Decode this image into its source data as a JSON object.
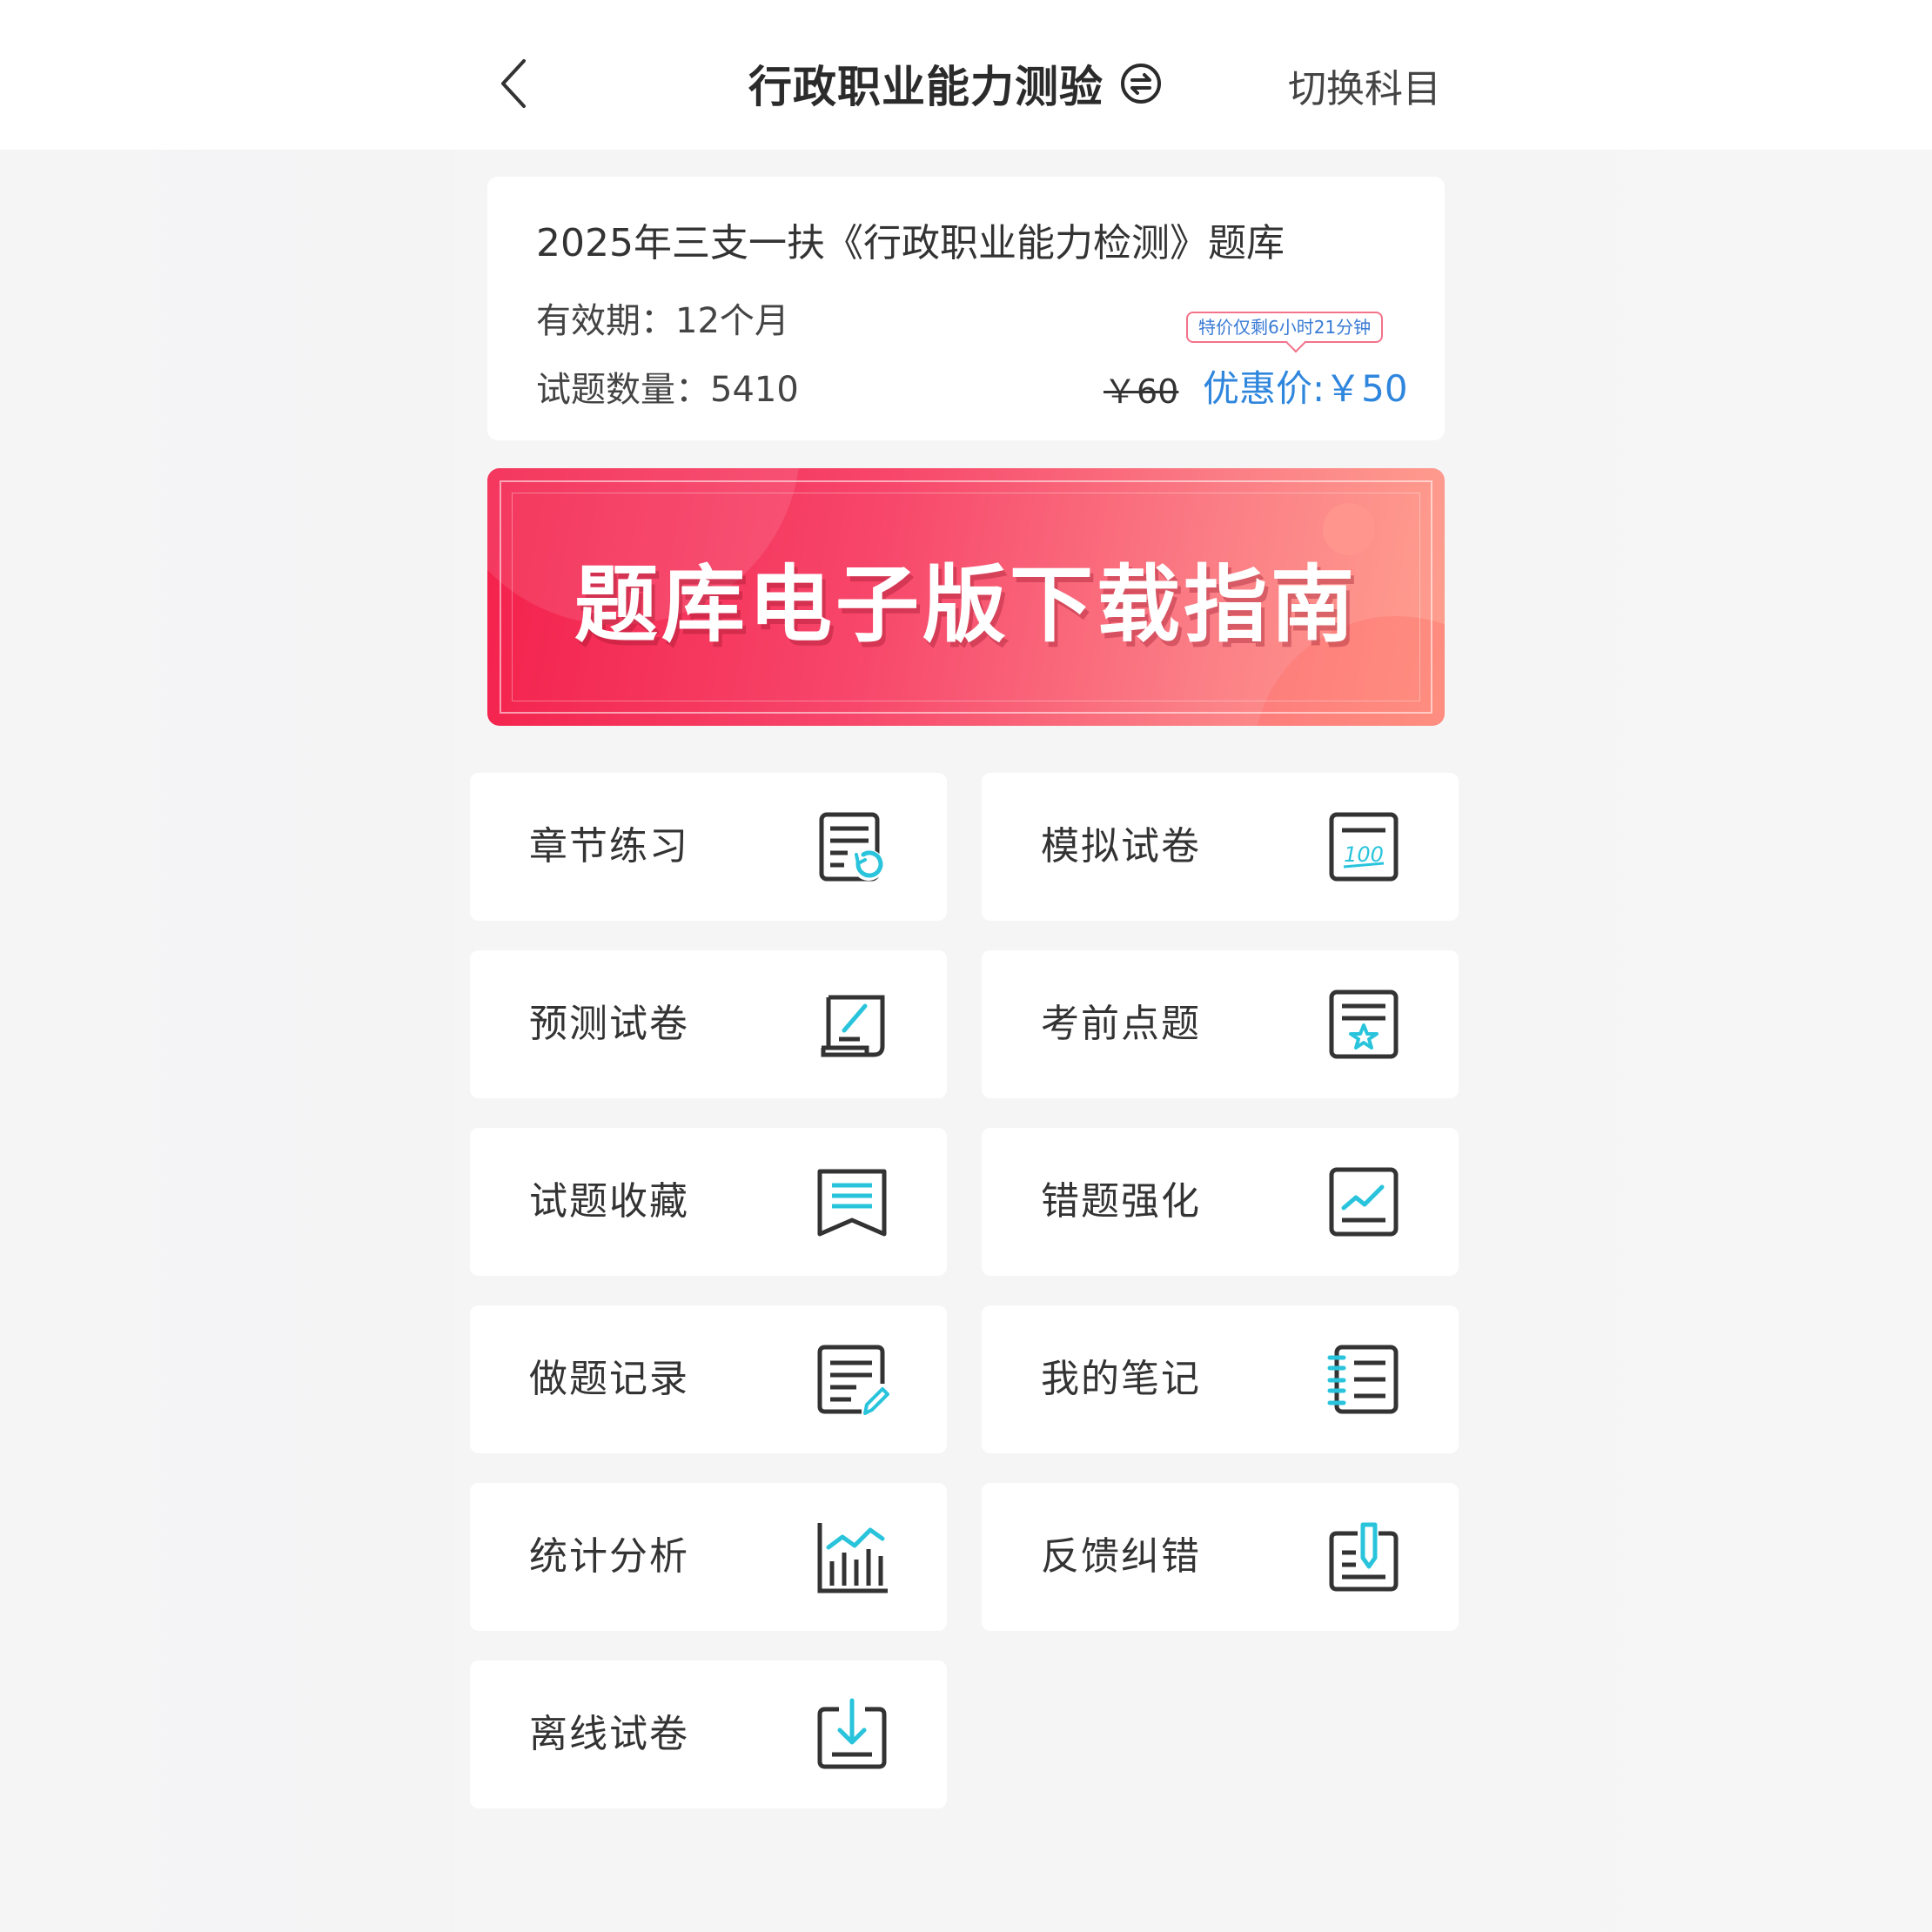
{
  "header": {
    "title": "行政职业能力测验",
    "switch_label": "切换科目"
  },
  "info": {
    "bank_title": "2025年三支一扶《行政职业能力检测》题库",
    "validity": "有效期：12个月",
    "question_count": "试题数量：5410",
    "countdown": "特价仅剩6小时21分钟",
    "old_price": "￥60",
    "sale_price": "优惠价:￥50"
  },
  "banner": {
    "text": "题库电子版下载指南"
  },
  "menu": {
    "items": [
      {
        "label": "章节练习",
        "icon": "chapter-practice-icon"
      },
      {
        "label": "模拟试卷",
        "icon": "mock-exam-icon"
      },
      {
        "label": "预测试卷",
        "icon": "forecast-exam-icon"
      },
      {
        "label": "考前点题",
        "icon": "key-points-icon"
      },
      {
        "label": "试题收藏",
        "icon": "favorites-icon"
      },
      {
        "label": "错题强化",
        "icon": "mistakes-icon"
      },
      {
        "label": "做题记录",
        "icon": "practice-record-icon"
      },
      {
        "label": "我的笔记",
        "icon": "notes-icon"
      },
      {
        "label": "统计分析",
        "icon": "statistics-icon"
      },
      {
        "label": "反馈纠错",
        "icon": "feedback-icon"
      },
      {
        "label": "离线试卷",
        "icon": "offline-exam-icon"
      }
    ]
  },
  "colors": {
    "accent_blue": "#2f86dd",
    "icon_cyan": "#29c4dc",
    "icon_dark": "#333333",
    "banner_red": "#f3214c"
  }
}
